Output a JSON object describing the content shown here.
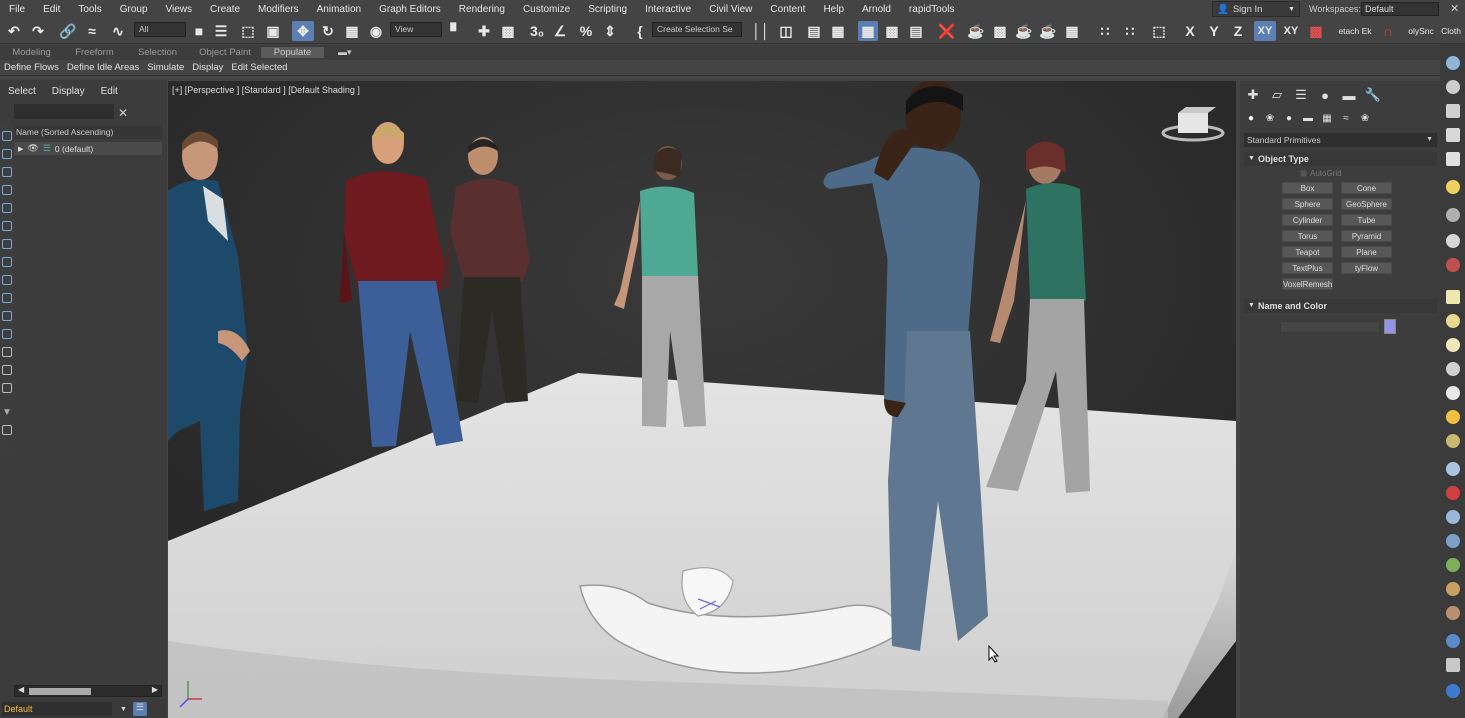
{
  "menubar": {
    "items": [
      "File",
      "Edit",
      "Tools",
      "Group",
      "Views",
      "Create",
      "Modifiers",
      "Animation",
      "Graph Editors",
      "Rendering",
      "Customize",
      "Scripting",
      "Interactive",
      "Civil View",
      "Content",
      "Help",
      "Arnold",
      "rapidTools"
    ],
    "sign_in": "Sign In",
    "workspaces_label": "Workspaces:",
    "workspace_value": "Default"
  },
  "toolbar": {
    "selection_filter": "All",
    "ref_coord": "View",
    "named_selection": "Create Selection Se",
    "axis_x": "X",
    "axis_y": "Y",
    "axis_z": "Z",
    "axis_xy": "XY",
    "axis_xy2": "XY",
    "detach_label": "etach Ek",
    "polysnc_label": "olySnc",
    "cloth_label": "Cloth"
  },
  "ribbon": {
    "tabs": [
      "Modeling",
      "Freeform",
      "Selection",
      "Object Paint",
      "Populate"
    ],
    "active_tab": "Populate",
    "tools": [
      "Define Flows",
      "Define Idle Areas",
      "Simulate",
      "Display",
      "Edit Selected"
    ]
  },
  "scene_explorer": {
    "tabs": [
      "Select",
      "Display",
      "Edit"
    ],
    "column_header": "Name (Sorted Ascending)",
    "rows": [
      {
        "label": "0 (default)"
      }
    ]
  },
  "status": {
    "layer": "Default"
  },
  "viewport": {
    "label": "[+] [Perspective ] [Standard ] [Default Shading ]"
  },
  "command_panel": {
    "category": "Standard Primitives",
    "object_type_title": "Object Type",
    "autogrid_label": "AutoGrid",
    "buttons": [
      "Box",
      "Cone",
      "Sphere",
      "GeoSphere",
      "Cylinder",
      "Tube",
      "Torus",
      "Pyramid",
      "Teapot",
      "Plane",
      "TextPlus",
      "tyFlow",
      "VoxelRemesh"
    ],
    "name_color_title": "Name and Color",
    "object_color": "#9494e6"
  },
  "colors": {
    "accent": "#5b7fb3",
    "background": "#444444",
    "viewport_bg": "#303030",
    "layer_text": "#f0c040"
  }
}
